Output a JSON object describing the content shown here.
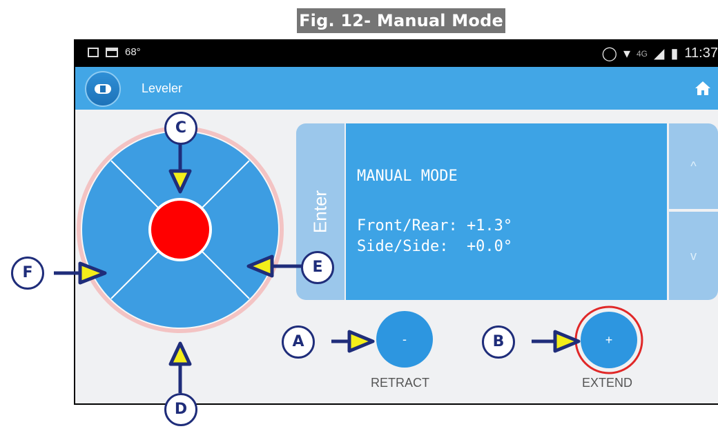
{
  "figure": {
    "title": "Fig. 12- Manual Mode"
  },
  "status_bar": {
    "temperature": "68°",
    "network": "4G",
    "time": "11:37",
    "icons": [
      "image-icon",
      "message-icon",
      "vibrate-icon",
      "wifi-icon",
      "signal-icon",
      "battery-icon"
    ]
  },
  "app_bar": {
    "title": "Leveler",
    "logo": "leveler-logo",
    "home_icon": "home-icon"
  },
  "display": {
    "enter_label": "Enter",
    "line1": "MANUAL MODE",
    "line2": "Front/Rear: +1.3°",
    "line3": "Side/Side:  +0.0°",
    "up_label": "^",
    "down_label": "v"
  },
  "buttons": {
    "retract_symbol": "-",
    "retract_label": "RETRACT",
    "extend_symbol": "+",
    "extend_label": "EXTEND"
  },
  "callouts": {
    "a": "A",
    "b": "B",
    "c": "C",
    "d": "D",
    "e": "E",
    "f": "F"
  },
  "colors": {
    "app_blue": "#42a6e6",
    "pad_blue": "#3d9de2",
    "center_red": "#ff0000",
    "callout_navy": "#1f2d7a",
    "arrow_yellow": "#f4ee1a",
    "highlight_ring": "#e02828"
  }
}
